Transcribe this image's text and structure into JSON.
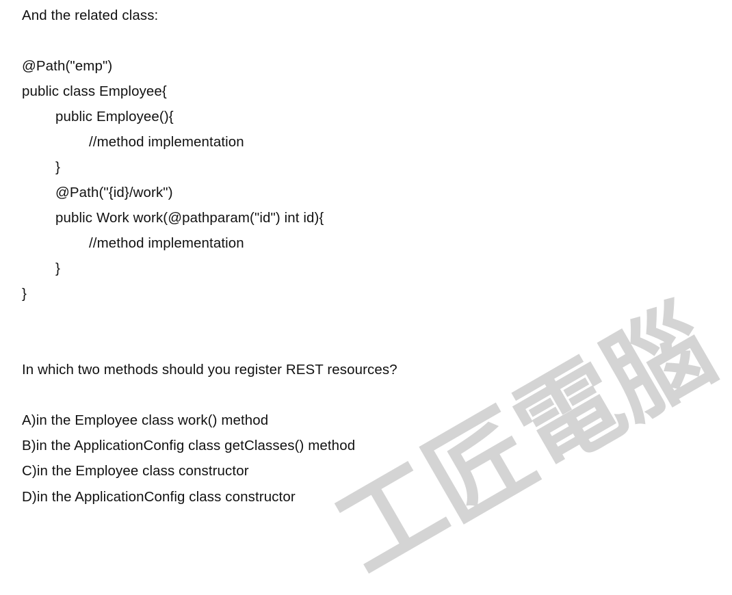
{
  "intro": "And the related class:",
  "code": {
    "annotation_class": "@Path(\"emp\")",
    "class_decl": "public class Employee{",
    "ctor_decl": "public Employee(){",
    "ctor_body": "//method implementation",
    "ctor_close": "}",
    "annotation_method": "@Path(\"{id}/work\")",
    "method_decl": "public Work work(@pathparam(\"id\") int id){",
    "method_body": "//method implementation",
    "method_close": "}",
    "class_close": "}"
  },
  "question": "In which two methods should you register REST resources?",
  "options": [
    "A)in the Employee class work() method",
    "B)in the ApplicationConfig class getClasses() method",
    "C)in the Employee class constructor",
    "D)in the ApplicationConfig class constructor"
  ],
  "watermark": "工匠電腦"
}
